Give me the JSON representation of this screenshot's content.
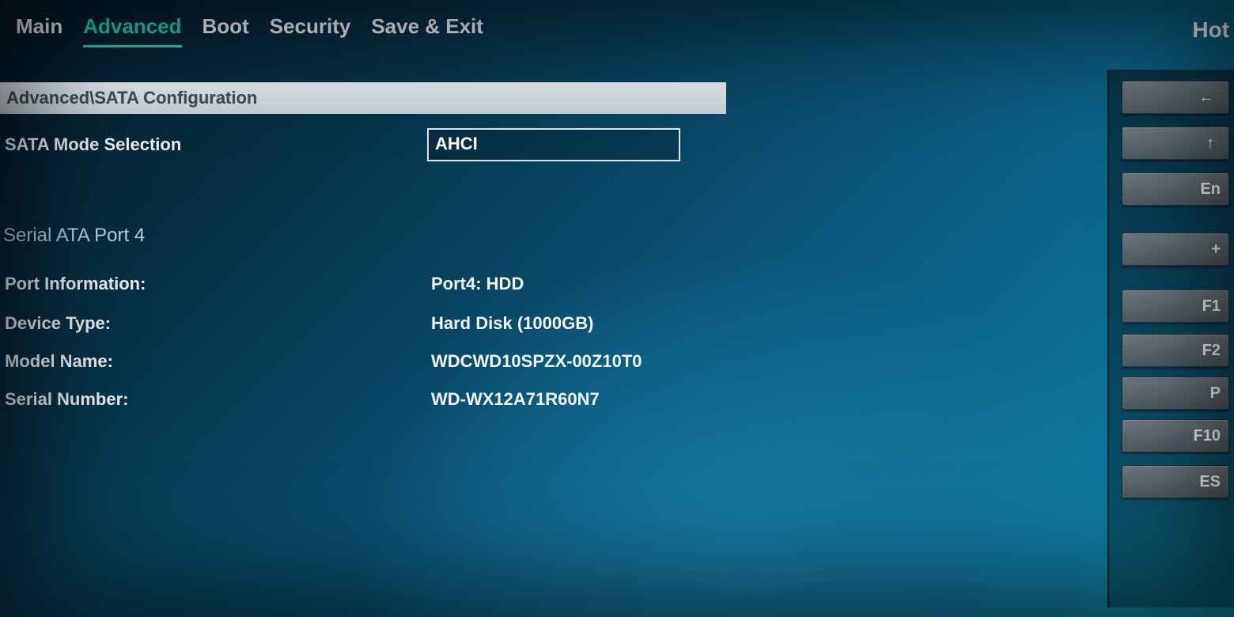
{
  "header": {
    "tabs": [
      "Main",
      "Advanced",
      "Boot",
      "Security",
      "Save & Exit"
    ],
    "active_tab_index": 1,
    "right_label": "Hot"
  },
  "breadcrumb": "Advanced\\SATA Configuration",
  "sata_mode": {
    "label": "SATA Mode Selection",
    "value": "AHCI"
  },
  "port_section_title": "Serial ATA Port 4",
  "port_info": {
    "label": "Port Information:",
    "value": "Port4: HDD"
  },
  "device_type": {
    "label": "Device Type:",
    "value": "Hard Disk (1000GB)"
  },
  "model_name": {
    "label": "Model Name:",
    "value": "WDCWD10SPZX-00Z10T0"
  },
  "serial_number": {
    "label": "Serial Number:",
    "value": "WD-WX12A71R60N7"
  },
  "side_hints": {
    "p1": "←",
    "p2": "↑",
    "p3": "En",
    "p4": "+",
    "p5": "F1",
    "p6": "F2",
    "p7": "P",
    "p8": "F10",
    "p9": "ES"
  }
}
